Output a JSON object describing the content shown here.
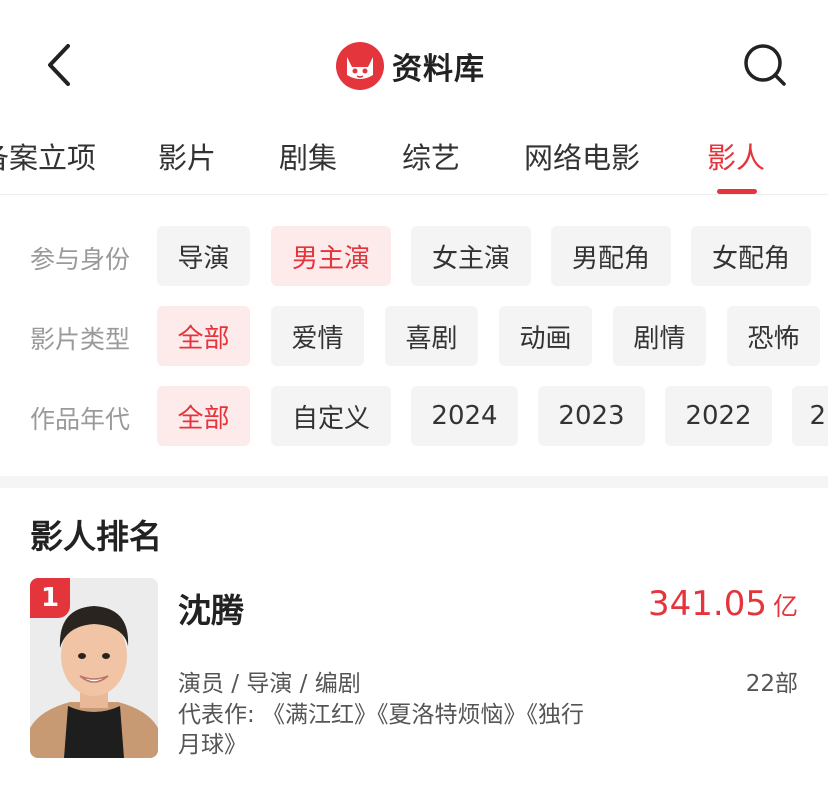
{
  "header": {
    "title": "资料库",
    "brand_color": "#e4353c",
    "back_icon": "chevron-left-icon",
    "search_icon": "search-icon"
  },
  "tabs": [
    {
      "label": "备案立项"
    },
    {
      "label": "影片"
    },
    {
      "label": "剧集"
    },
    {
      "label": "综艺"
    },
    {
      "label": "网络电影"
    },
    {
      "label": "影人",
      "active": true
    }
  ],
  "filters": {
    "identity": {
      "label": "参与身份",
      "options": [
        "导演",
        "男主演",
        "女主演",
        "男配角",
        "女配角"
      ],
      "selected": "男主演"
    },
    "genre": {
      "label": "影片类型",
      "options": [
        "全部",
        "爱情",
        "喜剧",
        "动画",
        "剧情",
        "恐怖"
      ],
      "selected": "全部"
    },
    "era": {
      "label": "作品年代",
      "options": [
        "全部",
        "自定义",
        "2024",
        "2023",
        "2022",
        "2"
      ],
      "selected": "全部"
    }
  },
  "ranking": {
    "title": "影人排名",
    "items": [
      {
        "rank": "1",
        "name": "沈腾",
        "box_office": "341.05",
        "box_office_unit": "亿",
        "roles": "演员 / 导演 / 编剧",
        "works_count": "22部",
        "representative": "代表作: 《满江红》《夏洛特烦恼》《独行月球》"
      }
    ]
  }
}
